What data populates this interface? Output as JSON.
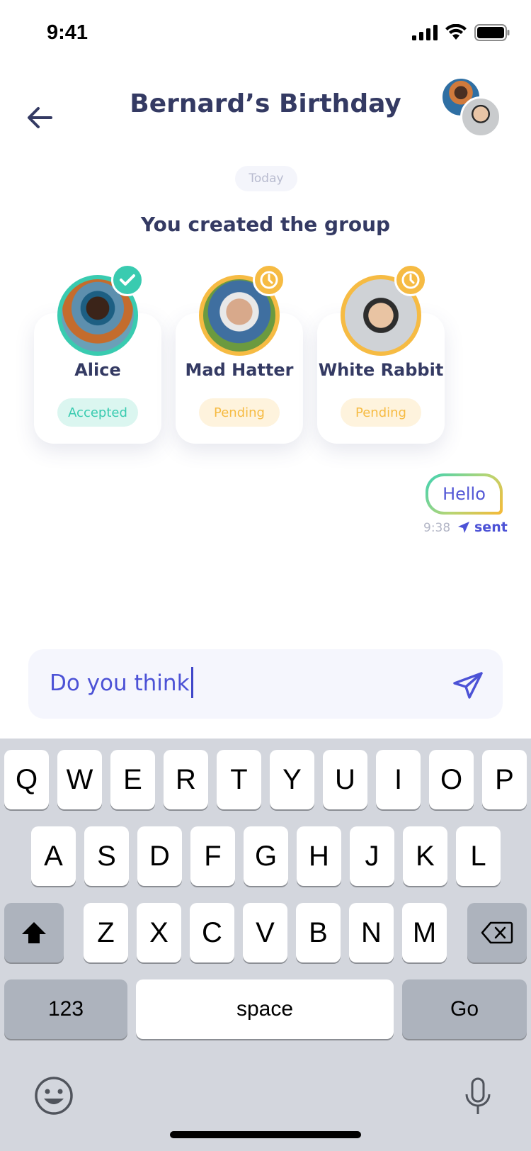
{
  "status_bar": {
    "time": "9:41"
  },
  "header": {
    "title": "Bernard’s Birthday"
  },
  "chat": {
    "date_chip": "Today",
    "system_message": "You created the group",
    "members": [
      {
        "name": "Alice",
        "status": "Accepted",
        "status_color": "#39cbb0"
      },
      {
        "name": "Mad Hatter",
        "status": "Pending",
        "status_color": "#f6bb43"
      },
      {
        "name": "White Rabbit",
        "status": "Pending",
        "status_color": "#f6bb43"
      }
    ],
    "messages": [
      {
        "text": "Hello",
        "time": "9:38",
        "status": "sent"
      }
    ]
  },
  "composer": {
    "value": "Do you think"
  },
  "keyboard": {
    "row1": [
      "Q",
      "W",
      "E",
      "R",
      "T",
      "Y",
      "U",
      "I",
      "O",
      "P"
    ],
    "row2": [
      "A",
      "S",
      "D",
      "F",
      "G",
      "H",
      "J",
      "K",
      "L"
    ],
    "row3": [
      "Z",
      "X",
      "C",
      "V",
      "B",
      "N",
      "M"
    ],
    "numbers_label": "123",
    "space_label": "space",
    "go_label": "Go"
  },
  "colors": {
    "primary_text": "#343a63",
    "accent_blue": "#4c52d6",
    "accepted": "#39cbb0",
    "pending": "#f6bb43"
  }
}
